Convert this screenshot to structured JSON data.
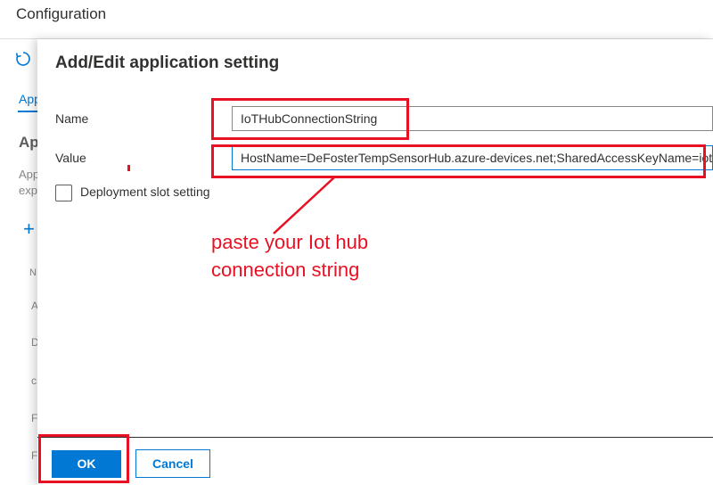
{
  "header": {
    "title": "Configuration"
  },
  "background_blade": {
    "tab_label": "App",
    "heading": "App",
    "description_lines": [
      "App",
      "exp"
    ],
    "column_initial": "N",
    "row_initials": [
      "A",
      "D",
      "c",
      "F",
      "F"
    ]
  },
  "dialog": {
    "title": "Add/Edit application setting",
    "name_label": "Name",
    "name_value": "IoTHubConnectionString",
    "value_label": "Value",
    "value_value": "HostName=DeFosterTempSensorHub.azure-devices.net;SharedAccessKeyName=iothubowner;SharedAccessKey=",
    "slot_setting_label": "Deployment slot setting",
    "slot_setting_checked": false,
    "ok_label": "OK",
    "cancel_label": "Cancel"
  },
  "annotation": {
    "line1": "paste your Iot hub",
    "line2": "connection string",
    "color": "#e81123"
  },
  "colors": {
    "accent": "#0078d4",
    "text": "#323130",
    "annotation": "#e81123"
  }
}
